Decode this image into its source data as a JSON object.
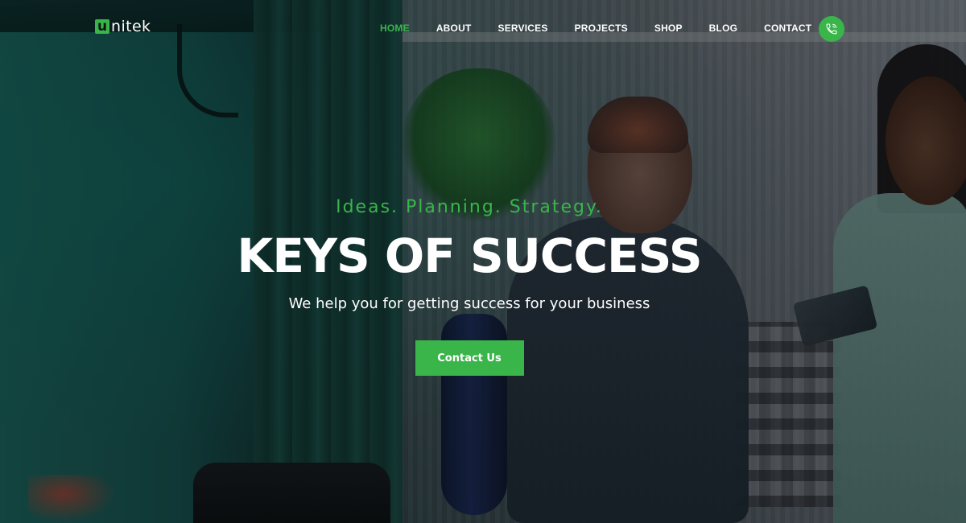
{
  "brand": {
    "logo_mark": "u",
    "logo_text": "nitek",
    "accent_color": "#39b54a"
  },
  "nav": {
    "items": [
      {
        "label": "HOME",
        "active": true
      },
      {
        "label": "ABOUT",
        "active": false
      },
      {
        "label": "SERVICES",
        "active": false
      },
      {
        "label": "PROJECTS",
        "active": false
      },
      {
        "label": "SHOP",
        "active": false
      },
      {
        "label": "BLOG",
        "active": false
      },
      {
        "label": "CONTACT",
        "active": false
      }
    ],
    "phone_icon": "phone-icon"
  },
  "hero": {
    "tagline": "Ideas. Planning. Strategy.",
    "headline": "KEYS OF SUCCESS",
    "subhead": "We help you for getting success for your business",
    "cta_label": "Contact Us"
  }
}
